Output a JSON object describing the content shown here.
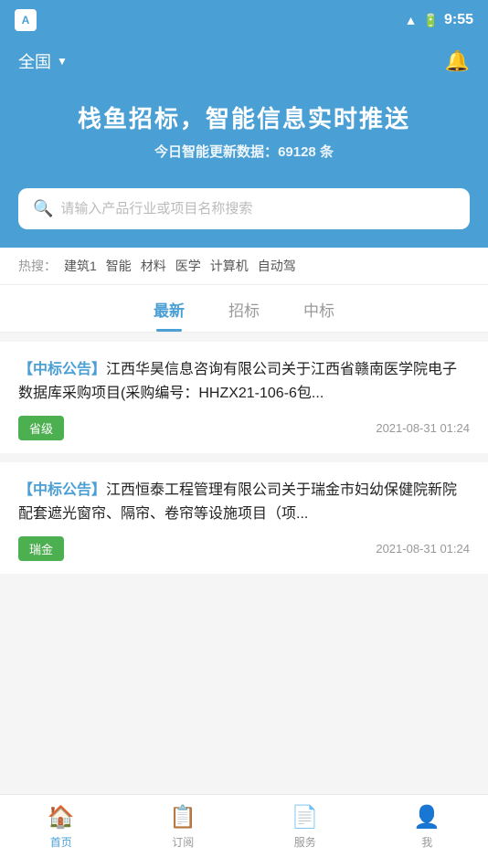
{
  "statusBar": {
    "time": "9:55",
    "appIcon": "A"
  },
  "header": {
    "region": "全国",
    "bellIcon": "🔔"
  },
  "hero": {
    "title": "栈鱼招标，智能信息实时推送",
    "subtitlePrefix": "今日智能更新数据：",
    "count": "69128",
    "subtitleSuffix": " 条"
  },
  "search": {
    "placeholder": "请输入产品行业或项目名称搜索"
  },
  "hotSearch": {
    "label": "热搜：",
    "tags": [
      "建筑1",
      "智能",
      "材料",
      "医学",
      "计算机",
      "自动驾"
    ]
  },
  "tabs": [
    {
      "id": "latest",
      "label": "最新",
      "active": true
    },
    {
      "id": "bidding",
      "label": "招标",
      "active": false
    },
    {
      "id": "winning",
      "label": "中标",
      "active": false
    }
  ],
  "newsList": [
    {
      "tag": "【中标公告】",
      "title": "江西华昊信息咨询有限公司关于江西省赣南医学院电子数据库采购项目(采购编号：HHZX21-106-6包...",
      "badge": "省级",
      "time": "2021-08-31 01:24"
    },
    {
      "tag": "【中标公告】",
      "title": "江西恒泰工程管理有限公司关于瑞金市妇幼保健院新院配套遮光窗帘、隔帘、卷帘等设施项目（项...",
      "badge": "瑞金",
      "time": "2021-08-31 01:24"
    }
  ],
  "bottomNav": [
    {
      "id": "home",
      "icon": "🏠",
      "label": "首页",
      "active": true
    },
    {
      "id": "subscribe",
      "icon": "📋",
      "label": "订阅",
      "active": false
    },
    {
      "id": "service",
      "icon": "📄",
      "label": "服务",
      "active": false
    },
    {
      "id": "profile",
      "icon": "👤",
      "label": "我",
      "active": false
    }
  ]
}
